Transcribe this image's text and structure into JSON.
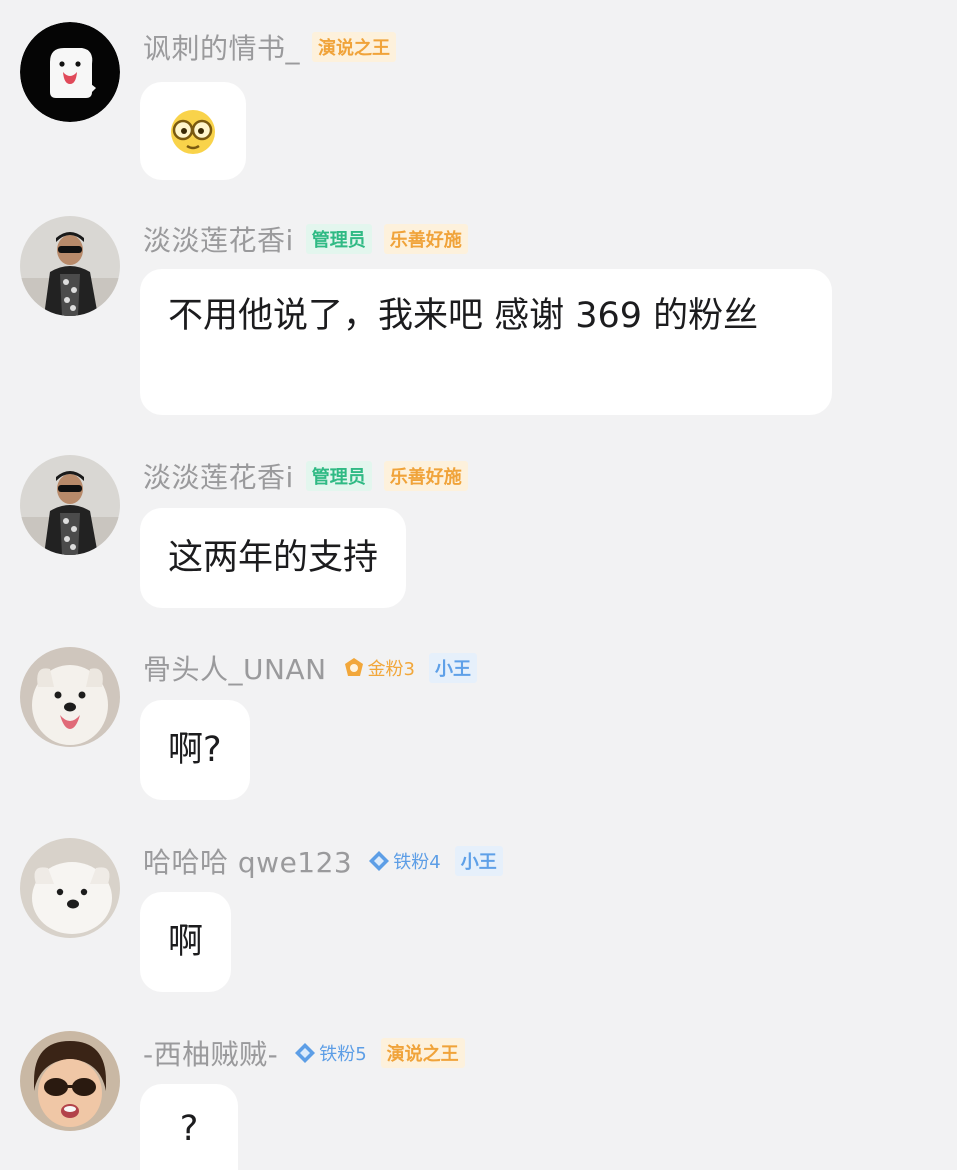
{
  "messages": [
    {
      "username": "讽刺的情书_",
      "badges": [
        {
          "label": "演说之王",
          "color": "#f0a33a"
        }
      ],
      "content": "",
      "content_icon": "nerd-glasses-emoji-icon",
      "avatar": "white-toast-cartoon-avatar"
    },
    {
      "username": "淡淡莲花香i",
      "badges": [
        {
          "label": "管理员",
          "color": "#2fba84"
        },
        {
          "label": "乐善好施",
          "color": "#f0a33a"
        }
      ],
      "content": "不用他说了，我来吧 感谢 369 的粉丝",
      "avatar": "man-sunglasses-avatar"
    },
    {
      "username": "淡淡莲花香i",
      "badges": [
        {
          "label": "管理员",
          "color": "#2fba84"
        },
        {
          "label": "乐善好施",
          "color": "#f0a33a"
        }
      ],
      "content": "这两年的支持",
      "avatar": "man-sunglasses-avatar"
    },
    {
      "username": "骨头人_UNAN",
      "badges": [
        {
          "label": "金粉3",
          "color": "#f2a73a",
          "icon": "gold-fan-icon"
        },
        {
          "label": "小王",
          "color": "#5ea0e8"
        }
      ],
      "content": "啊?",
      "avatar": "white-dog-avatar"
    },
    {
      "username": "哈哈哈 qwe123",
      "badges": [
        {
          "label": "铁粉4",
          "color": "#5d9ee6",
          "icon": "iron-fan-icon"
        },
        {
          "label": "小王",
          "color": "#5ea0e8"
        }
      ],
      "content": "啊",
      "avatar": "white-puppy-avatar"
    },
    {
      "username": "-西柚贼贼-",
      "badges": [
        {
          "label": "铁粉5",
          "color": "#5d9ee6",
          "icon": "iron-fan-icon"
        },
        {
          "label": "演说之王",
          "color": "#f0a33a"
        }
      ],
      "content": "?",
      "avatar": "child-sunglasses-avatar"
    }
  ]
}
